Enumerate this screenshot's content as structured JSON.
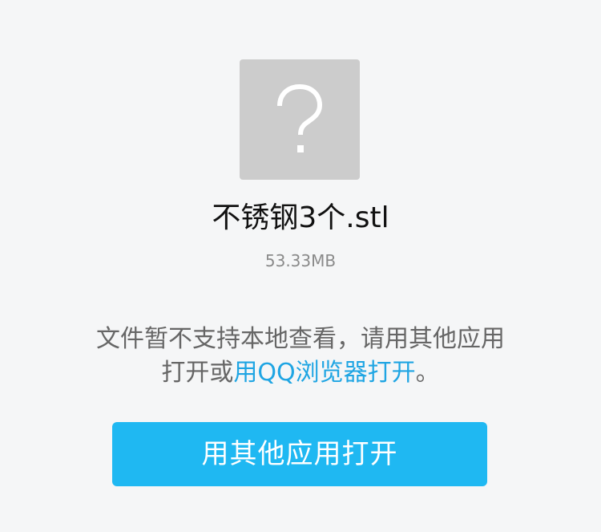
{
  "file": {
    "icon": "question-mark-icon",
    "name": "不锈钢3个.stl",
    "size": "53.33MB"
  },
  "notice": {
    "line1": "文件暂不支持本地查看，请用其他应用",
    "line2_prefix": "打开或",
    "link_text": "用QQ浏览器打开",
    "line2_suffix": "。"
  },
  "actions": {
    "open_other_app_label": "用其他应用打开"
  },
  "colors": {
    "background": "#f5f6f7",
    "icon_bg": "#cccccc",
    "link": "#1fa5e3",
    "button": "#1fb8f2"
  }
}
